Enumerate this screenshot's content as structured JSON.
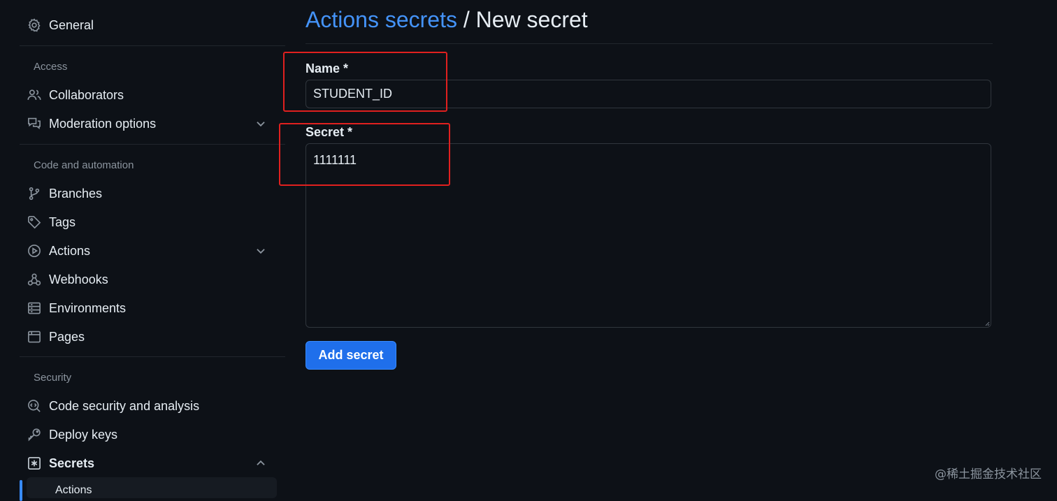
{
  "sidebar": {
    "general": "General",
    "sections": {
      "access": "Access",
      "code_automation": "Code and automation",
      "security": "Security"
    },
    "items": {
      "collaborators": "Collaborators",
      "moderation": "Moderation options",
      "branches": "Branches",
      "tags": "Tags",
      "actions": "Actions",
      "webhooks": "Webhooks",
      "environments": "Environments",
      "pages": "Pages",
      "code_security": "Code security and analysis",
      "deploy_keys": "Deploy keys",
      "secrets": "Secrets",
      "secrets_actions": "Actions"
    }
  },
  "main": {
    "breadcrumb_link": "Actions secrets",
    "breadcrumb_sep": " / ",
    "breadcrumb_current": "New secret",
    "name_label": "Name *",
    "name_value": "STUDENT_ID",
    "secret_label": "Secret *",
    "secret_value": "1111111",
    "add_button": "Add secret"
  },
  "watermark": "@稀土掘金技术社区",
  "colors": {
    "background": "#0d1117",
    "link": "#4493f8",
    "primary_button": "#1f6feb",
    "highlight_box": "#e0201f"
  }
}
